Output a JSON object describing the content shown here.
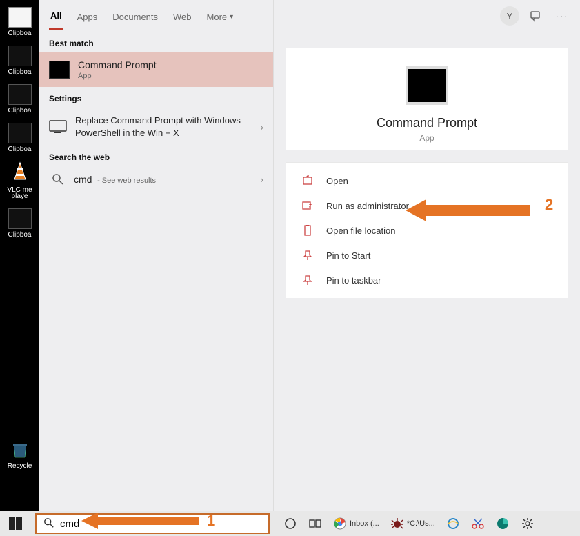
{
  "desktop": {
    "labels": {
      "clip1": "Clipboa",
      "clip2": "Clipboa",
      "clip3": "Clipboa",
      "clip4": "Clipboa",
      "vlc": "VLC me",
      "vlc2": "playe",
      "clip5": "Clipboa",
      "recycle": "Recycle"
    }
  },
  "tabs": {
    "all": "All",
    "apps": "Apps",
    "documents": "Documents",
    "web": "Web",
    "more": "More"
  },
  "sections": {
    "best": "Best match",
    "settings": "Settings",
    "search_web": "Search the web"
  },
  "results": {
    "cmd_title": "Command Prompt",
    "cmd_sub": "App",
    "setting_line": "Replace Command Prompt with Windows PowerShell in the Win + X",
    "web_q": "cmd",
    "web_sub": "- See web results"
  },
  "details": {
    "title": "Command Prompt",
    "sub": "App",
    "avatar_letter": "Y"
  },
  "actions": {
    "open": "Open",
    "run_admin": "Run as administrator",
    "open_loc": "Open file location",
    "pin_start": "Pin to Start",
    "pin_taskbar": "Pin to taskbar"
  },
  "search_input": {
    "value": "cmd"
  },
  "taskbar": {
    "inbox": "Inbox (...",
    "cmdwin": "*C:\\Us..."
  },
  "annotations": {
    "n1": "1",
    "n2": "2"
  }
}
